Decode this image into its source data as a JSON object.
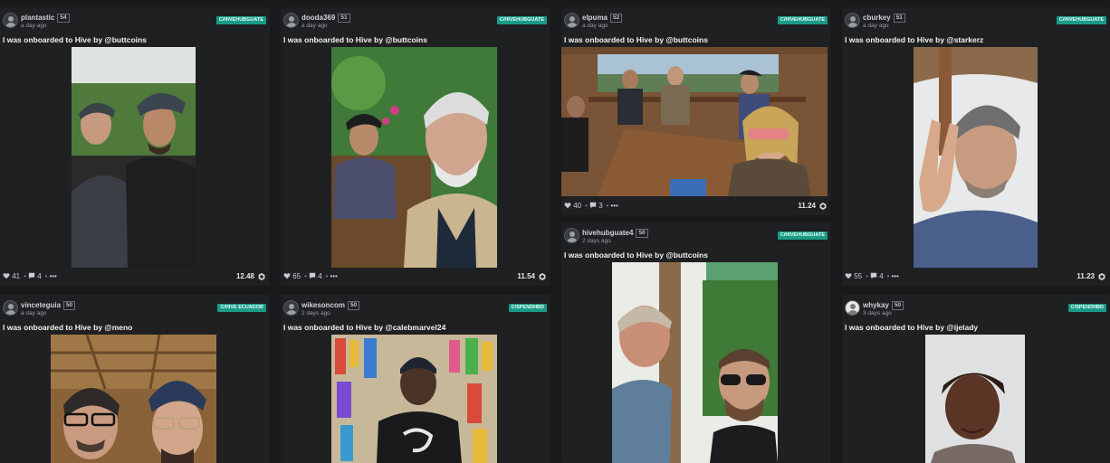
{
  "posts": [
    {
      "author": "plantastic",
      "rep": "54",
      "time": "a day ago",
      "community": "C/HIVEHUBGUATE",
      "title": "I was onboarded to Hive by @buttcoins",
      "likes": "41",
      "comments": "4",
      "payout": "12.48"
    },
    {
      "author": "dooda369",
      "rep": "51",
      "time": "a day ago",
      "community": "C/HIVEHUBGUATE",
      "title": "I was onboarded to Hive by @buttcoins",
      "likes": "65",
      "comments": "4",
      "payout": "11.54"
    },
    {
      "author": "elpuma",
      "rep": "52",
      "time": "a day ago",
      "community": "C/HIVEHUBGUATE",
      "title": "I was onboarded to Hive by @buttcoins",
      "likes": "40",
      "comments": "3",
      "payout": "11.24"
    },
    {
      "author": "cburkey",
      "rep": "51",
      "time": "a day ago",
      "community": "C/HIVEHUBGUATE",
      "title": "I was onboarded to Hive by @starkerz",
      "likes": "55",
      "comments": "4",
      "payout": "11.23"
    },
    {
      "author": "vinceteguia",
      "rep": "50",
      "time": "a day ago",
      "community": "C/HIVE ECUADOR",
      "title": "I was onboarded to Hive by @meno"
    },
    {
      "author": "wikesoncom",
      "rep": "50",
      "time": "2 days ago",
      "community": "C/SPENDHBD",
      "title": "I was onboarded to Hive by @calebmarvel24"
    },
    {
      "author": "hivehubguate4",
      "rep": "50",
      "time": "2 days ago",
      "community": "C/HIVEHUBGUATE",
      "title": "I was onboarded to Hive by @buttcoins"
    },
    {
      "author": "whykay",
      "rep": "50",
      "time": "3 days ago",
      "community": "C/SPENDHBD",
      "title": "I was onboarded to Hive by @ijelady"
    }
  ],
  "icons": {
    "like": "heart-icon",
    "comment": "comment-icon",
    "more": "more-icon",
    "payout": "hive-icon"
  },
  "colors": {
    "community_badge": "#1b9b86",
    "card_bg": "#1f2022",
    "page_bg": "#18191b"
  },
  "more_label": "•••",
  "separator": "•"
}
